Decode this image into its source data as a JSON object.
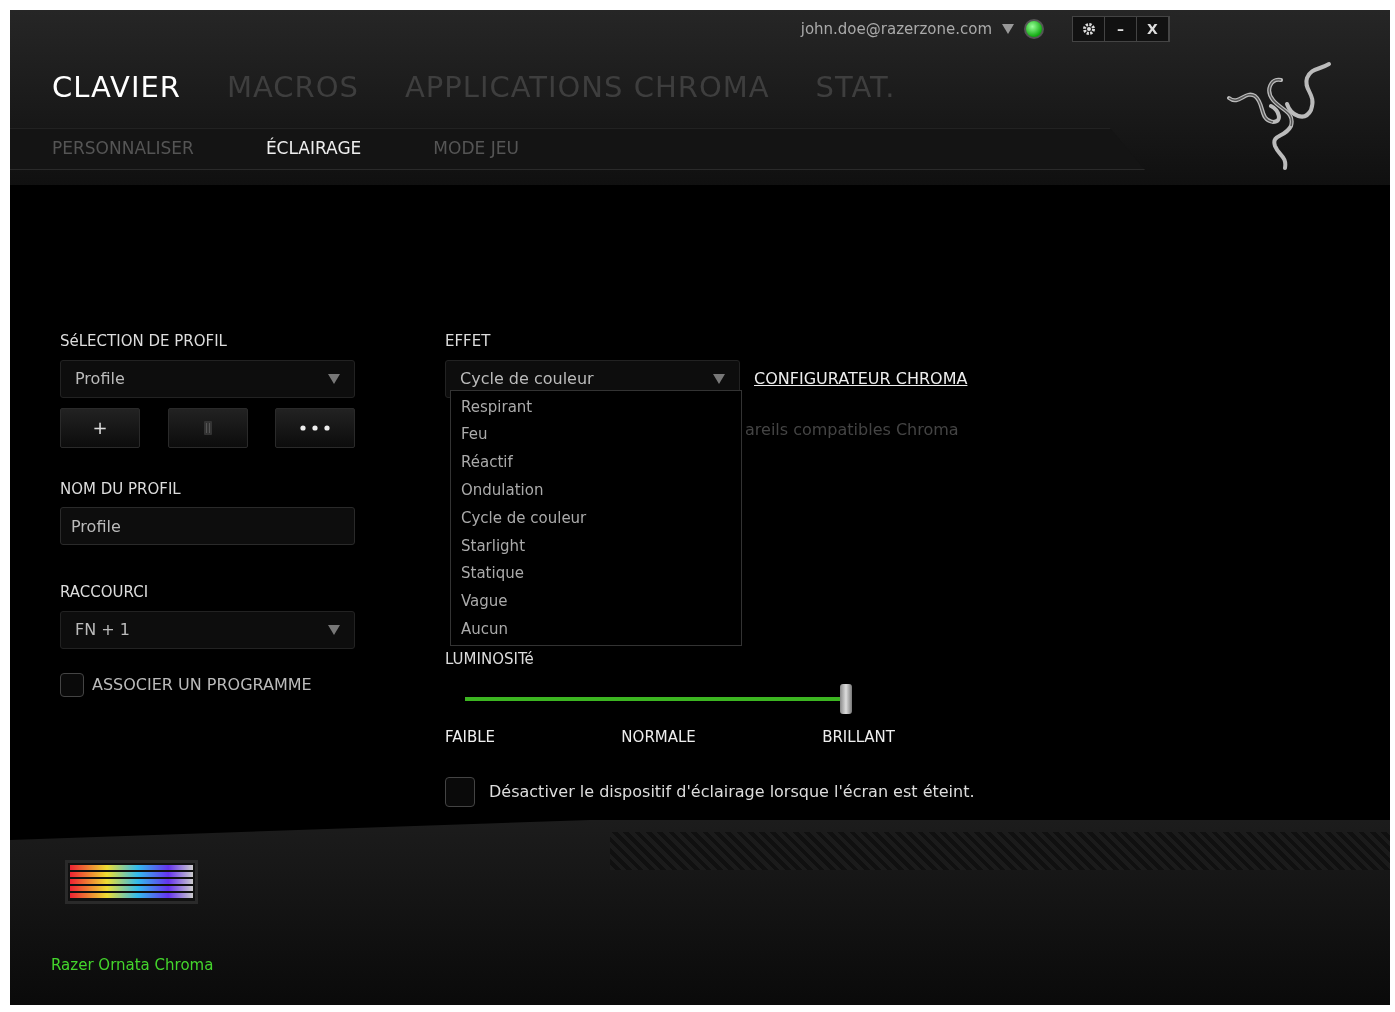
{
  "account": {
    "email": "john.doe@razerzone.com",
    "online": true
  },
  "window_controls": [
    {
      "kind": "settings"
    },
    {
      "kind": "minimize",
      "label": "–"
    },
    {
      "kind": "close",
      "label": "X"
    }
  ],
  "tabs": [
    {
      "label": "CLAVIER",
      "selected": true
    },
    {
      "label": "MACROS",
      "selected": false
    },
    {
      "label": "APPLICATIONS CHROMA",
      "selected": false
    },
    {
      "label": "STAT.",
      "selected": false
    }
  ],
  "subtabs": [
    {
      "label": "PERSONNALISER",
      "selected": false
    },
    {
      "label": "ÉCLAIRAGE",
      "selected": true
    },
    {
      "label": "MODE JEU",
      "selected": false
    }
  ],
  "profile": {
    "selection_label": "SéLECTION DE PROFIL",
    "selection_value": "Profile",
    "buttons": [
      {
        "kind": "add",
        "label": "+"
      },
      {
        "kind": "delete"
      },
      {
        "kind": "more"
      }
    ],
    "name_label": "NOM DU PROFIL",
    "name_value": "Profile",
    "shortcut_label": "RACCOURCI",
    "shortcut_value": "FN + 1",
    "link_program": {
      "label": "ASSOCIER UN PROGRAMME",
      "checked": false
    }
  },
  "effect": {
    "label": "EFFET",
    "value": "Cycle de couleur",
    "expanded": true,
    "link": "CONFIGURATEUR CHROMA",
    "options": [
      "Respirant",
      "Feu",
      "Réactif",
      "Ondulation",
      "Cycle de couleur",
      "Starlight",
      "Statique",
      "Vague",
      "Aucun"
    ],
    "covered_text": "areils compatibles Chroma"
  },
  "brightness": {
    "label": "LUMINOSITé",
    "level": 1,
    "marks": [
      "FAIBLE",
      "NORMALE",
      "BRILLANT"
    ]
  },
  "screen_off": {
    "label": "Désactiver le dispositif d'éclairage lorsque l'écran est éteint.",
    "checked": false
  },
  "device": {
    "name": "Razer Ornata Chroma"
  }
}
